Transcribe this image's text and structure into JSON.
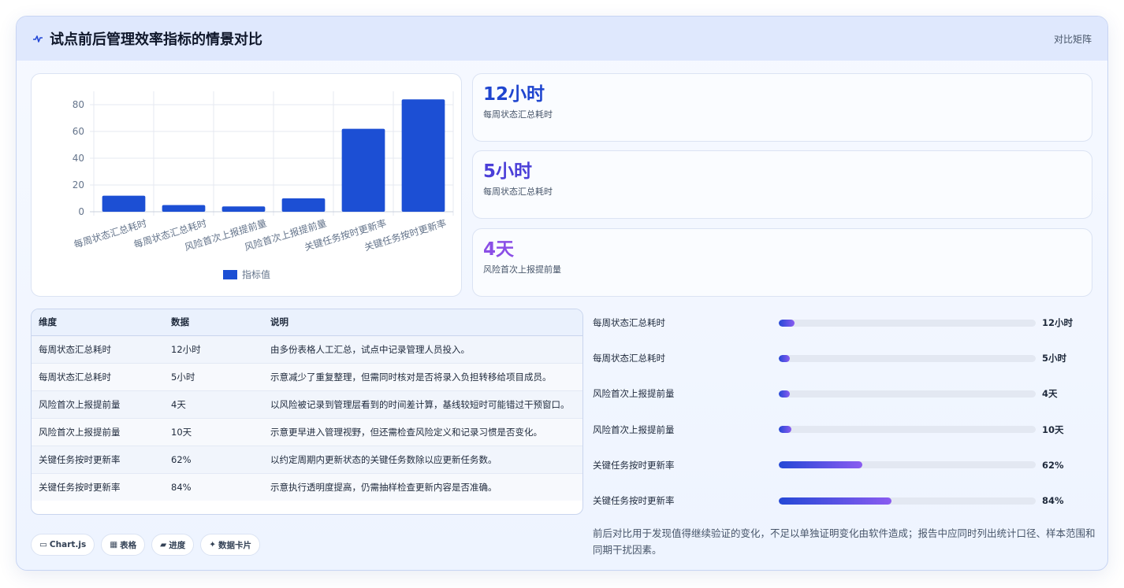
{
  "header": {
    "title": "试点前后管理效率指标的情景对比",
    "right_label": "对比矩阵"
  },
  "chart_data": {
    "type": "bar",
    "categories": [
      "每周状态汇总耗时",
      "每周状态汇总耗时",
      "风险首次上报提前量",
      "风险首次上报提前量",
      "关键任务按时更新率",
      "关键任务按时更新率"
    ],
    "series": [
      {
        "name": "指标值",
        "values": [
          12,
          5,
          4,
          10,
          62,
          84
        ]
      }
    ],
    "ylim": [
      0,
      90
    ],
    "yticks": [
      0,
      20,
      40,
      60,
      80
    ],
    "grid": true,
    "legend": "bottom",
    "color": "#1c4fd4"
  },
  "stats": [
    {
      "value": "12小时",
      "label": "每周状态汇总耗时",
      "color": "#1f45cf"
    },
    {
      "value": "5小时",
      "label": "每周状态汇总耗时",
      "color": "#4b3fd8"
    },
    {
      "value": "4天",
      "label": "风险首次上报提前量",
      "color": "#8a4ee6"
    }
  ],
  "table": {
    "headers": [
      "维度",
      "数据",
      "说明"
    ],
    "rows": [
      [
        "每周状态汇总耗时",
        "12小时",
        "由多份表格人工汇总，试点中记录管理人员投入。"
      ],
      [
        "每周状态汇总耗时",
        "5小时",
        "示意减少了重复整理，但需同时核对是否将录入负担转移给项目成员。"
      ],
      [
        "风险首次上报提前量",
        "4天",
        "以风险被记录到管理层看到的时间差计算，基线较短时可能错过干预窗口。"
      ],
      [
        "风险首次上报提前量",
        "10天",
        "示意更早进入管理视野，但还需检查风险定义和记录习惯是否变化。"
      ],
      [
        "关键任务按时更新率",
        "62%",
        "以约定周期内更新状态的关键任务数除以应更新任务数。"
      ],
      [
        "关键任务按时更新率",
        "84%",
        "示意执行透明度提高，仍需抽样检查更新内容是否准确。"
      ]
    ]
  },
  "progress": [
    {
      "label": "每周状态汇总耗时",
      "value": "12小时",
      "fraction": 0.06
    },
    {
      "label": "每周状态汇总耗时",
      "value": "5小时",
      "fraction": 0.04
    },
    {
      "label": "风险首次上报提前量",
      "value": "4天",
      "fraction": 0.04
    },
    {
      "label": "风险首次上报提前量",
      "value": "10天",
      "fraction": 0.05
    },
    {
      "label": "关键任务按时更新率",
      "value": "62%",
      "fraction": 0.325
    },
    {
      "label": "关键任务按时更新率",
      "value": "84%",
      "fraction": 0.44
    }
  ],
  "note": "前后对比用于发现值得继续验证的变化，不足以单独证明变化由软件造成；报告中应同时列出统计口径、样本范围和同期干扰因素。",
  "tags": [
    {
      "icon": "▭",
      "label": "Chart.js"
    },
    {
      "icon": "▦",
      "label": "表格"
    },
    {
      "icon": "▰",
      "label": "进度"
    },
    {
      "icon": "✦",
      "label": "数据卡片"
    }
  ]
}
